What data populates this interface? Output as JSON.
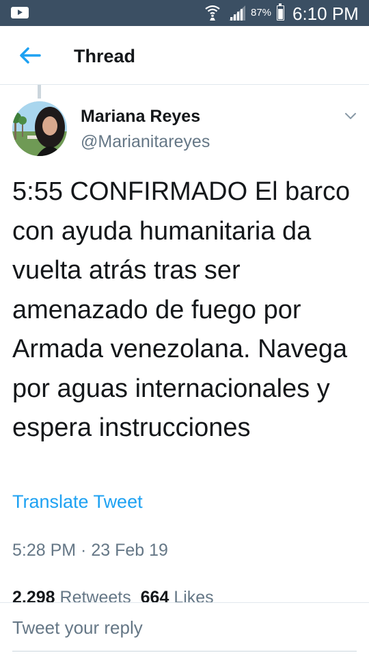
{
  "status_bar": {
    "battery_percent": "87%",
    "battery_level": 0.87,
    "time": "6:10 PM"
  },
  "header": {
    "title": "Thread"
  },
  "tweet": {
    "author_name": "Mariana Reyes",
    "author_handle": "@Marianitareyes",
    "text": "5:55 CONFIRMADO El barco con ayuda humanitaria da vuelta atrás tras ser amenazado de fuego por Armada venezolana. Navega por aguas internacionales y espera instrucciones",
    "translate_label": "Translate Tweet",
    "timestamp": "5:28 PM · 23 Feb 19",
    "retweets_count": "2,298",
    "retweets_label": "Retweets",
    "likes_count": "664",
    "likes_label": "Likes"
  },
  "reply": {
    "placeholder": "Tweet your reply"
  },
  "colors": {
    "status_bar": "#3b4f63",
    "accent": "#1da1f2",
    "secondary_text": "#657786"
  },
  "icons": [
    "app-notification-icon",
    "wifi-icon",
    "signal-icon",
    "battery-icon",
    "back-arrow-icon",
    "chevron-down-icon"
  ]
}
